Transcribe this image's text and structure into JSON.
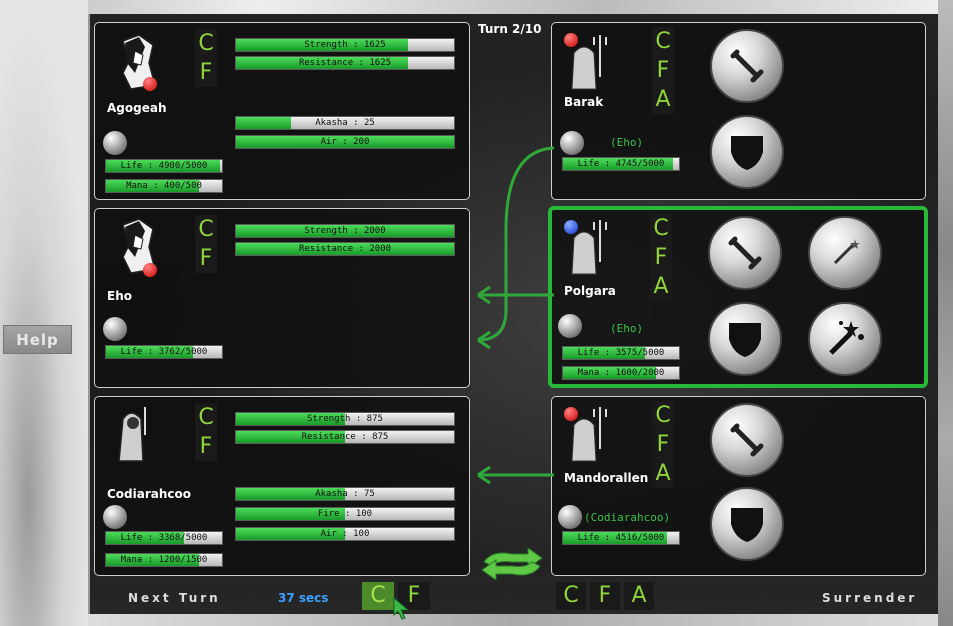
{
  "help_label": "Help",
  "turn_label": "Turn 2/10",
  "footer": {
    "next_turn": "Next Turn",
    "timer": "37 secs",
    "surrender": "Surrender",
    "own_letters": [
      "C",
      "F"
    ],
    "enemy_letters": [
      "C",
      "F",
      "A"
    ]
  },
  "left_units": [
    {
      "name": "Agogeah",
      "letters": [
        "C",
        "F"
      ],
      "stats": [
        {
          "label": "Strength : 1625",
          "pct": 0.74
        },
        {
          "label": "Resistance : 1625",
          "pct": 0.74
        }
      ],
      "stats2": [
        {
          "label": "Akasha : 25",
          "pct": 0.25
        },
        {
          "label": "Air : 200",
          "pct": 1.0
        }
      ],
      "life": {
        "label": "Life : 4900/5000",
        "pct": 0.98
      },
      "mana": {
        "label": "Mana : 400/500",
        "pct": 0.8
      }
    },
    {
      "name": "Eho",
      "letters": [
        "C",
        "F"
      ],
      "stats": [
        {
          "label": "Strength : 2000",
          "pct": 1.0
        },
        {
          "label": "Resistance : 2000",
          "pct": 1.0
        }
      ],
      "life": {
        "label": "Life : 3762/5000",
        "pct": 0.75
      }
    },
    {
      "name": "Codiarahcoo",
      "letters": [
        "C",
        "F"
      ],
      "stats": [
        {
          "label": "Strength : 875",
          "pct": 0.5
        },
        {
          "label": "Resistance : 875",
          "pct": 0.5
        }
      ],
      "stats2": [
        {
          "label": "Akasha : 75",
          "pct": 0.5
        },
        {
          "label": "Fire : 100",
          "pct": 0.5
        },
        {
          "label": "Air : 100",
          "pct": 0.5
        }
      ],
      "life": {
        "label": "Life : 3368/5000",
        "pct": 0.67
      },
      "mana": {
        "label": "Mana : 1200/1500",
        "pct": 0.8
      }
    }
  ],
  "right_units": [
    {
      "name": "Barak",
      "letters": [
        "C",
        "F",
        "A"
      ],
      "target": "(Eho)",
      "life": {
        "label": "Life : 4745/5000",
        "pct": 0.95
      }
    },
    {
      "name": "Polgara",
      "letters": [
        "C",
        "F",
        "A"
      ],
      "target": "(Eho)",
      "life": {
        "label": "Life : 3575/5000",
        "pct": 0.71
      },
      "mana": {
        "label": "Mana : 1600/2000",
        "pct": 0.8
      }
    },
    {
      "name": "Mandorallen",
      "letters": [
        "C",
        "F",
        "A"
      ],
      "target": "(Codiarahcoo)",
      "life": {
        "label": "Life : 4516/5000",
        "pct": 0.9
      }
    }
  ],
  "colors": {
    "accent": "#28b838",
    "letters": "#8fd43a",
    "timer": "#3aa0ff"
  }
}
